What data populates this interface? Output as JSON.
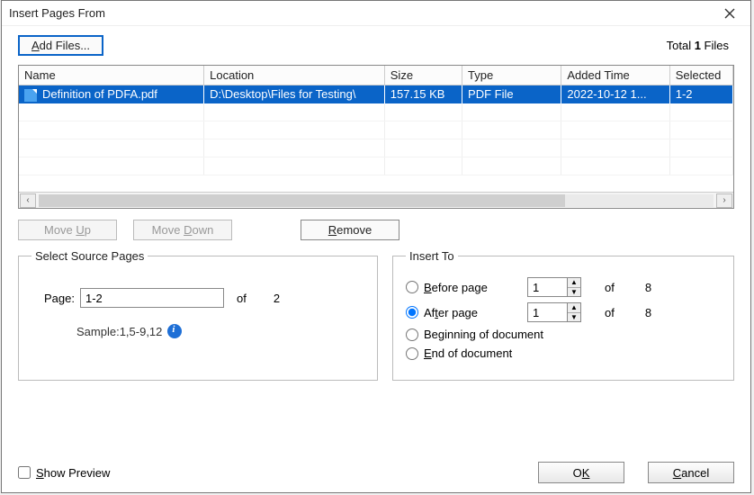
{
  "window": {
    "title": "Insert Pages From"
  },
  "toolbar": {
    "add_files_label": "Add Files...",
    "total_prefix": "Total ",
    "total_count": "1",
    "total_suffix": " Files"
  },
  "table": {
    "columns": [
      "Name",
      "Location",
      "Size",
      "Type",
      "Added Time",
      "Selected"
    ],
    "rows": [
      {
        "name": "Definition of PDFA.pdf",
        "location": "D:\\Desktop\\Files for Testing\\",
        "size": "157.15 KB",
        "type": "PDF File",
        "added_time": "2022-10-12 1...",
        "selected": "1-2"
      }
    ]
  },
  "actions": {
    "move_up": "Move Up",
    "move_down": "Move Down",
    "remove": "Remove"
  },
  "source": {
    "legend": "Select Source Pages",
    "page_label": "Page:",
    "page_value": "1-2",
    "of_label": "of",
    "page_total": "2",
    "sample": "Sample:1,5-9,12"
  },
  "insert": {
    "legend": "Insert To",
    "before_label": "Before page",
    "after_label": "After page",
    "beginning_label": "Beginning of document",
    "end_label": "End of document",
    "before_value": "1",
    "after_value": "1",
    "of_label": "of",
    "total_pages": "8"
  },
  "footer": {
    "show_preview": "Show Preview",
    "ok": "OK",
    "cancel": "Cancel"
  }
}
